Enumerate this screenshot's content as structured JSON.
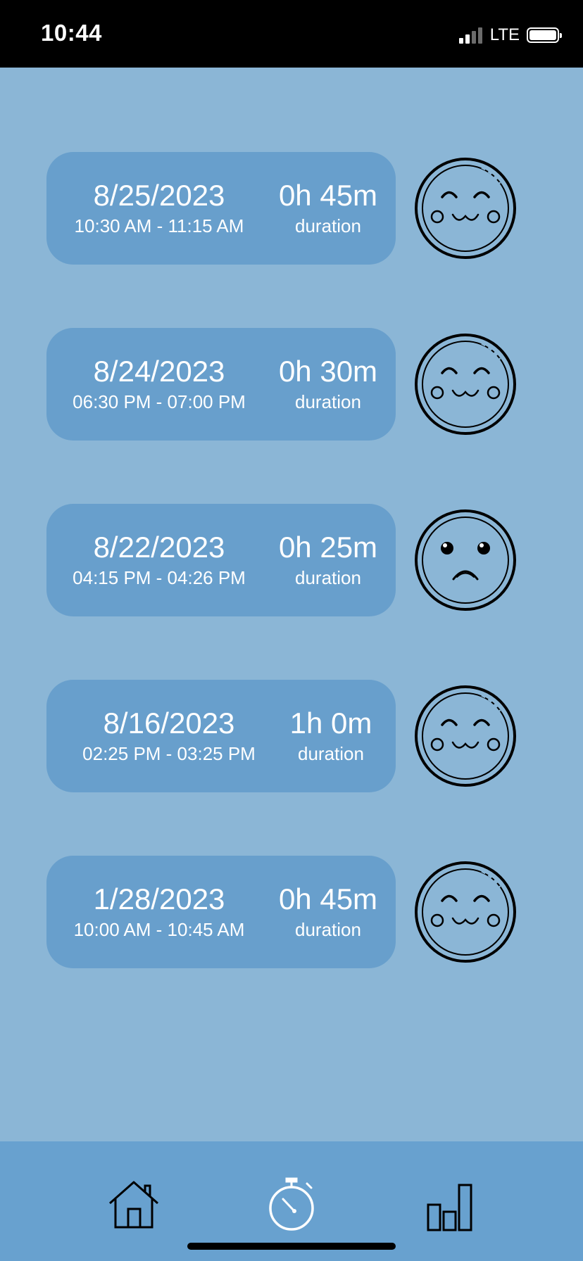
{
  "status_bar": {
    "time": "10:44",
    "network": "LTE"
  },
  "colors": {
    "background": "#8bb6d6",
    "card": "#689fcc",
    "tab_bar": "#68a1cf",
    "text": "#ffffff"
  },
  "sessions": [
    {
      "date": "8/25/2023",
      "time_range": "10:30 AM - 11:15 AM",
      "duration": "0h 45m",
      "duration_label": "duration",
      "mood": "happy-face-icon"
    },
    {
      "date": "8/24/2023",
      "time_range": "06:30 PM - 07:00 PM",
      "duration": "0h 30m",
      "duration_label": "duration",
      "mood": "happy-face-icon"
    },
    {
      "date": "8/22/2023",
      "time_range": "04:15 PM - 04:26 PM",
      "duration": "0h 25m",
      "duration_label": "duration",
      "mood": "sad-face-icon"
    },
    {
      "date": "8/16/2023",
      "time_range": "02:25 PM - 03:25 PM",
      "duration": "1h 0m",
      "duration_label": "duration",
      "mood": "happy-face-icon"
    },
    {
      "date": "1/28/2023",
      "time_range": "10:00 AM - 10:45 AM",
      "duration": "0h 45m",
      "duration_label": "duration",
      "mood": "happy-face-icon"
    }
  ],
  "tab_bar": {
    "tabs": [
      {
        "icon": "home-icon"
      },
      {
        "icon": "stopwatch-icon"
      },
      {
        "icon": "bar-chart-icon"
      }
    ]
  }
}
